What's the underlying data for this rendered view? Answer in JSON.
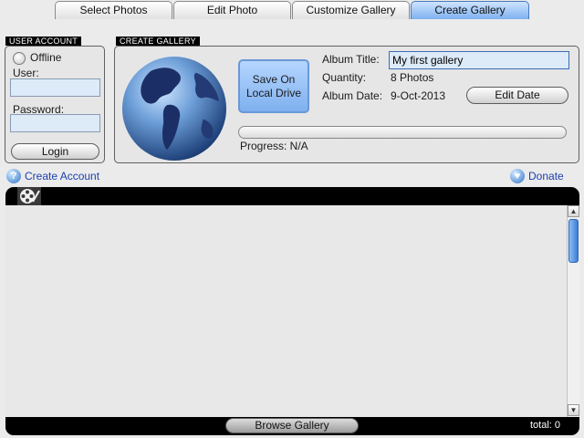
{
  "tabs": [
    {
      "label": "Select Photos"
    },
    {
      "label": "Edit Photo"
    },
    {
      "label": "Customize Gallery"
    },
    {
      "label": "Create Gallery"
    }
  ],
  "active_tab": "Create Gallery",
  "user_account": {
    "heading": "USER ACCOUNT",
    "offline_label": "Offline",
    "user_label": "User:",
    "user_value": "",
    "password_label": "Password:",
    "password_value": "",
    "login_label": "Login"
  },
  "create_gallery": {
    "heading": "CREATE GALLERY",
    "save_label_line1": "Save On",
    "save_label_line2": "Local Drive",
    "album_title_label": "Album Title:",
    "album_title_value": "My first gallery",
    "quantity_label": "Quantity:",
    "quantity_value": "8 Photos",
    "album_date_label": "Album Date:",
    "album_date_value": "9-Oct-2013",
    "edit_date_label": "Edit Date",
    "progress_label": "Progress: N/A"
  },
  "links": {
    "create_account": "Create Account",
    "donate": "Donate"
  },
  "gallery": {
    "browse_label": "Browse Gallery",
    "total_label": "total: 0"
  },
  "icons": {
    "help": "help-icon",
    "donate": "heart-icon",
    "film": "film-reel-icon",
    "globe": "globe-icon"
  },
  "colors": {
    "accent": "#7eb1ef",
    "field_bg": "#ddeaf8",
    "link": "#1c3fb0",
    "frame": "#000000"
  }
}
